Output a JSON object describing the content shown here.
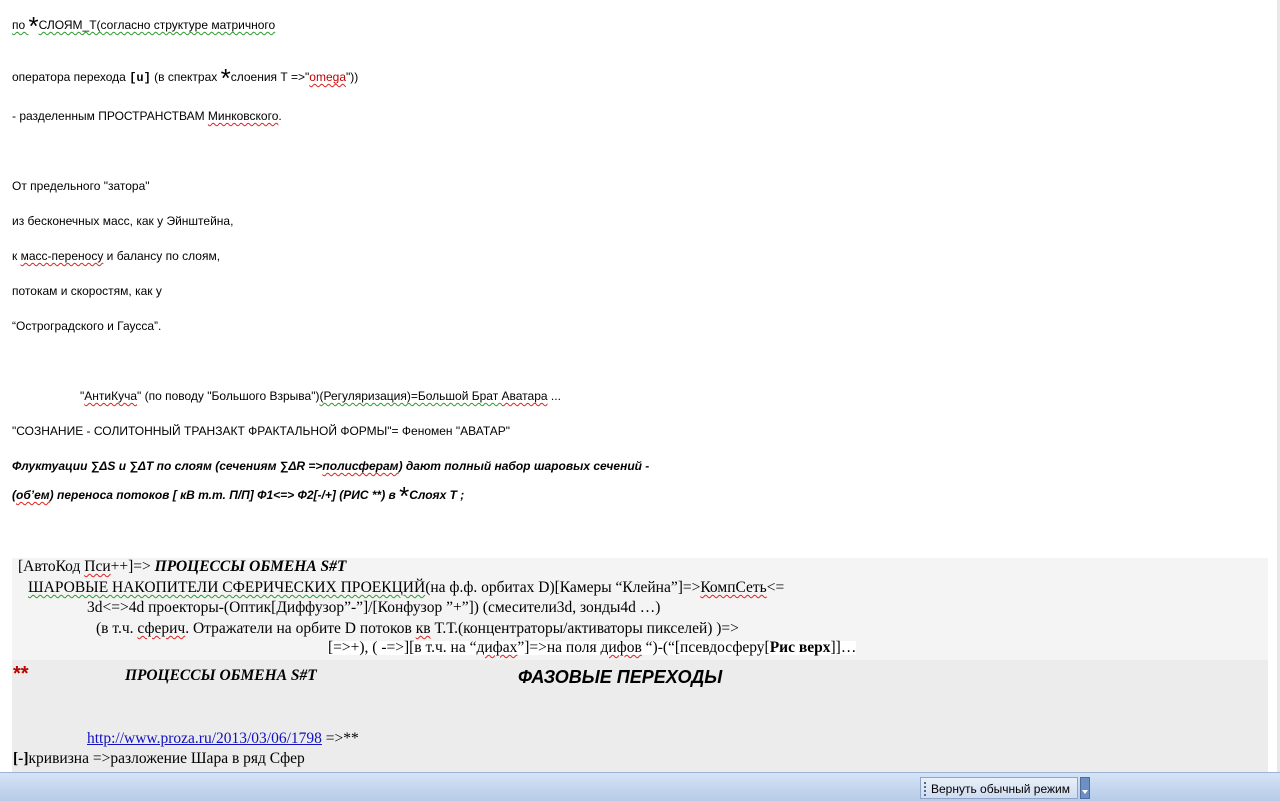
{
  "lines": {
    "l1_pre": "по ",
    "star": "*",
    "l1_post": "СЛОЯМ_Т(согласно структуре матричного",
    "l2_pre": "оператора перехода ",
    "l2_u": "[u]",
    "l2_mid": " (в спектрах ",
    "l2_post1": "слоения Т =>\"",
    "l2_omega": "omega",
    "l2_post2": "\"))",
    "l3a": "- разделенным ПРОСТРАНСТВАМ ",
    "l3b": "Минковского",
    "l3c": ".",
    "l4": "От предельного \"затора\"",
    "l5": "из бесконечных масс, как у Эйнштейна,",
    "l6a": "к ",
    "l6b": "масс-переносу",
    "l6c": " и балансу по слоям,",
    "l7": "потокам и скоростям, как у",
    "l8": "“Остроградского и Гаусса”.",
    "l9a": "\"",
    "l9b": "АнтиКуча",
    "l9c": "\" (по поводу \"Большого Взрыва\")",
    "l9d": "(Регуляризация)=Большой Брат ",
    "l9e": "Аватара",
    "l9f": " ...",
    "l10": "\"СОЗНАНИЕ - СОЛИТОННЫЙ ТРАНЗАКТ ФРАКТАЛЬНОЙ ФОРМЫ\"= Феномен \"АВАТАР\"",
    "l11a": "Флуктуации ∑ΔS и ∑ΔT по слоям (сечениям ∑ΔR =>",
    "l11b": "полисферам",
    "l11c": ") дают полный набор шаровых сечений  -",
    "l12a": "(",
    "l12b": "об’ем",
    "l12c": ") переноса потоков  [ кВ т.т.  П/П]   Ф1<=> Ф2[-/+]  (РИС **) в ",
    "l12d": "Слоях Т  ;"
  },
  "box": {
    "b1a": "[АвтоКод ",
    "b1b": "Пси",
    "b1c": "++]=> ",
    "b1d": "ПРОЦЕССЫ ОБМЕНА S#T",
    "b2a": "ШАРОВЫЕ НАКОПИТЕЛИ СФЕРИЧЕСКИХ ПРОЕКЦИЙ",
    "b2b": "(на ф.ф. орбитах D)[Камеры “Клейна”]=>",
    "b2c": "КомпСеть",
    "b2d": "<=",
    "b3": "3d<=>4d проекторы-(Оптик[Диффузор”-”]/[Конфузор ”+”]) (смесители3d, зонды4d …)",
    "b4a": "(в т.ч. ",
    "b4b": "сферич",
    "b4c": ". Отражатели на орбите D потоков ",
    "b4d": "кв",
    "b4e": " Т.Т.(концентраторы/активаторы пикселей) )=>",
    "b5a": "[=>+), ( -=>][в т.ч. на “",
    "b5b": "дифах",
    "b5c": "”]=>на поля ",
    "b5d": "дифов",
    "b5e": " “)-(“[псевдосферу[",
    "b5f": "Рис верх",
    "b5g": "]]…",
    "stars": "**",
    "proc": "ПРОЦЕССЫ ОБМЕНА S#T",
    "phase": "ФАЗОВЫЕ ПЕРЕХОДЫ",
    "url": "http://www.proza.ru/2013/03/06/1798",
    "url_post": " =>**",
    "last_a": "[-]",
    "last_b": "кривизна =>разложение Шара в ряд Сфер"
  },
  "taskbar": {
    "restore_label": "Вернуть обычный режим"
  },
  "colors": {
    "red": "#c00000",
    "link": "#1010c0",
    "taskbar": "#c6d7ef"
  }
}
